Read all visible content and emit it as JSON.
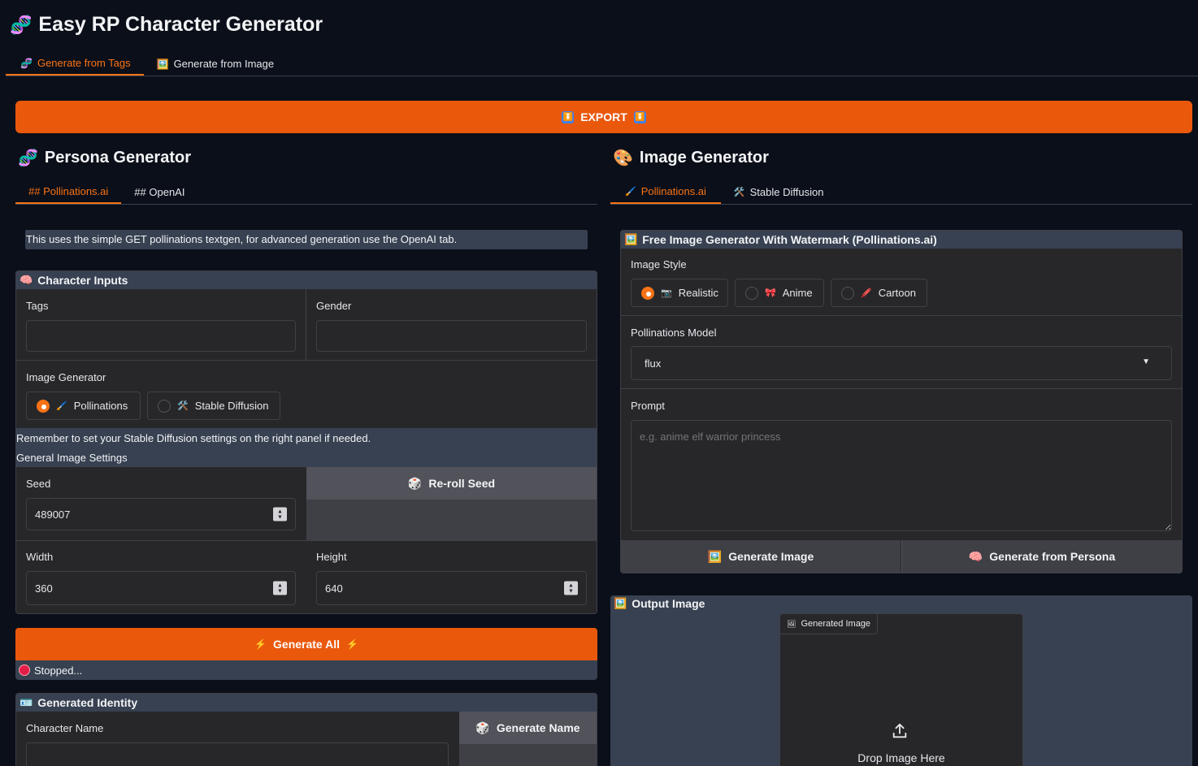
{
  "app": {
    "title": "Easy RP Character Generator",
    "main_tabs": [
      "Generate from Tags",
      "Generate from Image"
    ],
    "export_label": "EXPORT"
  },
  "persona": {
    "title": "Persona Generator",
    "tabs": [
      "## Pollinations.ai",
      "## OpenAI"
    ],
    "info_text": "This uses the simple GET pollinations textgen, for advanced generation use the OpenAI tab.",
    "inputs_title": "Character Inputs",
    "tags_label": "Tags",
    "tags_value": "",
    "gender_label": "Gender",
    "gender_value": "",
    "image_generator_label": "Image Generator",
    "image_generator_options": [
      "Pollinations",
      "Stable Diffusion"
    ],
    "image_generator_selected": "Pollinations",
    "reminder": "Remember to set your Stable Diffusion settings on the right panel if needed.",
    "general_settings": "General Image Settings",
    "seed_label": "Seed",
    "seed_value": "489007",
    "reroll_label": "Re-roll Seed",
    "width_label": "Width",
    "width_value": "360",
    "height_label": "Height",
    "height_value": "640",
    "generate_all_label": "Generate All",
    "status_text": "Stopped...",
    "identity_title": "Generated Identity",
    "char_name_label": "Character Name",
    "char_name_value": "",
    "generate_name_label": "Generate Name"
  },
  "image_gen": {
    "title": "Image Generator",
    "tabs": [
      "Pollinations.ai",
      "Stable Diffusion"
    ],
    "free_title": "Free Image Generator With Watermark (Pollinations.ai)",
    "style_label": "Image Style",
    "styles": [
      "Realistic",
      "Anime",
      "Cartoon"
    ],
    "style_selected": "Realistic",
    "model_label": "Pollinations Model",
    "model_value": "flux",
    "prompt_label": "Prompt",
    "prompt_placeholder": "e.g. anime elf warrior princess",
    "generate_image_label": "Generate Image",
    "generate_persona_label": "Generate from Persona",
    "output_title": "Output Image",
    "generated_image_label": "Generated Image",
    "drop_text": "Drop Image Here"
  },
  "colors": {
    "accent": "#ea580c",
    "accent_text": "#f97316",
    "background": "#0b0f19",
    "panel": "#27272a"
  }
}
